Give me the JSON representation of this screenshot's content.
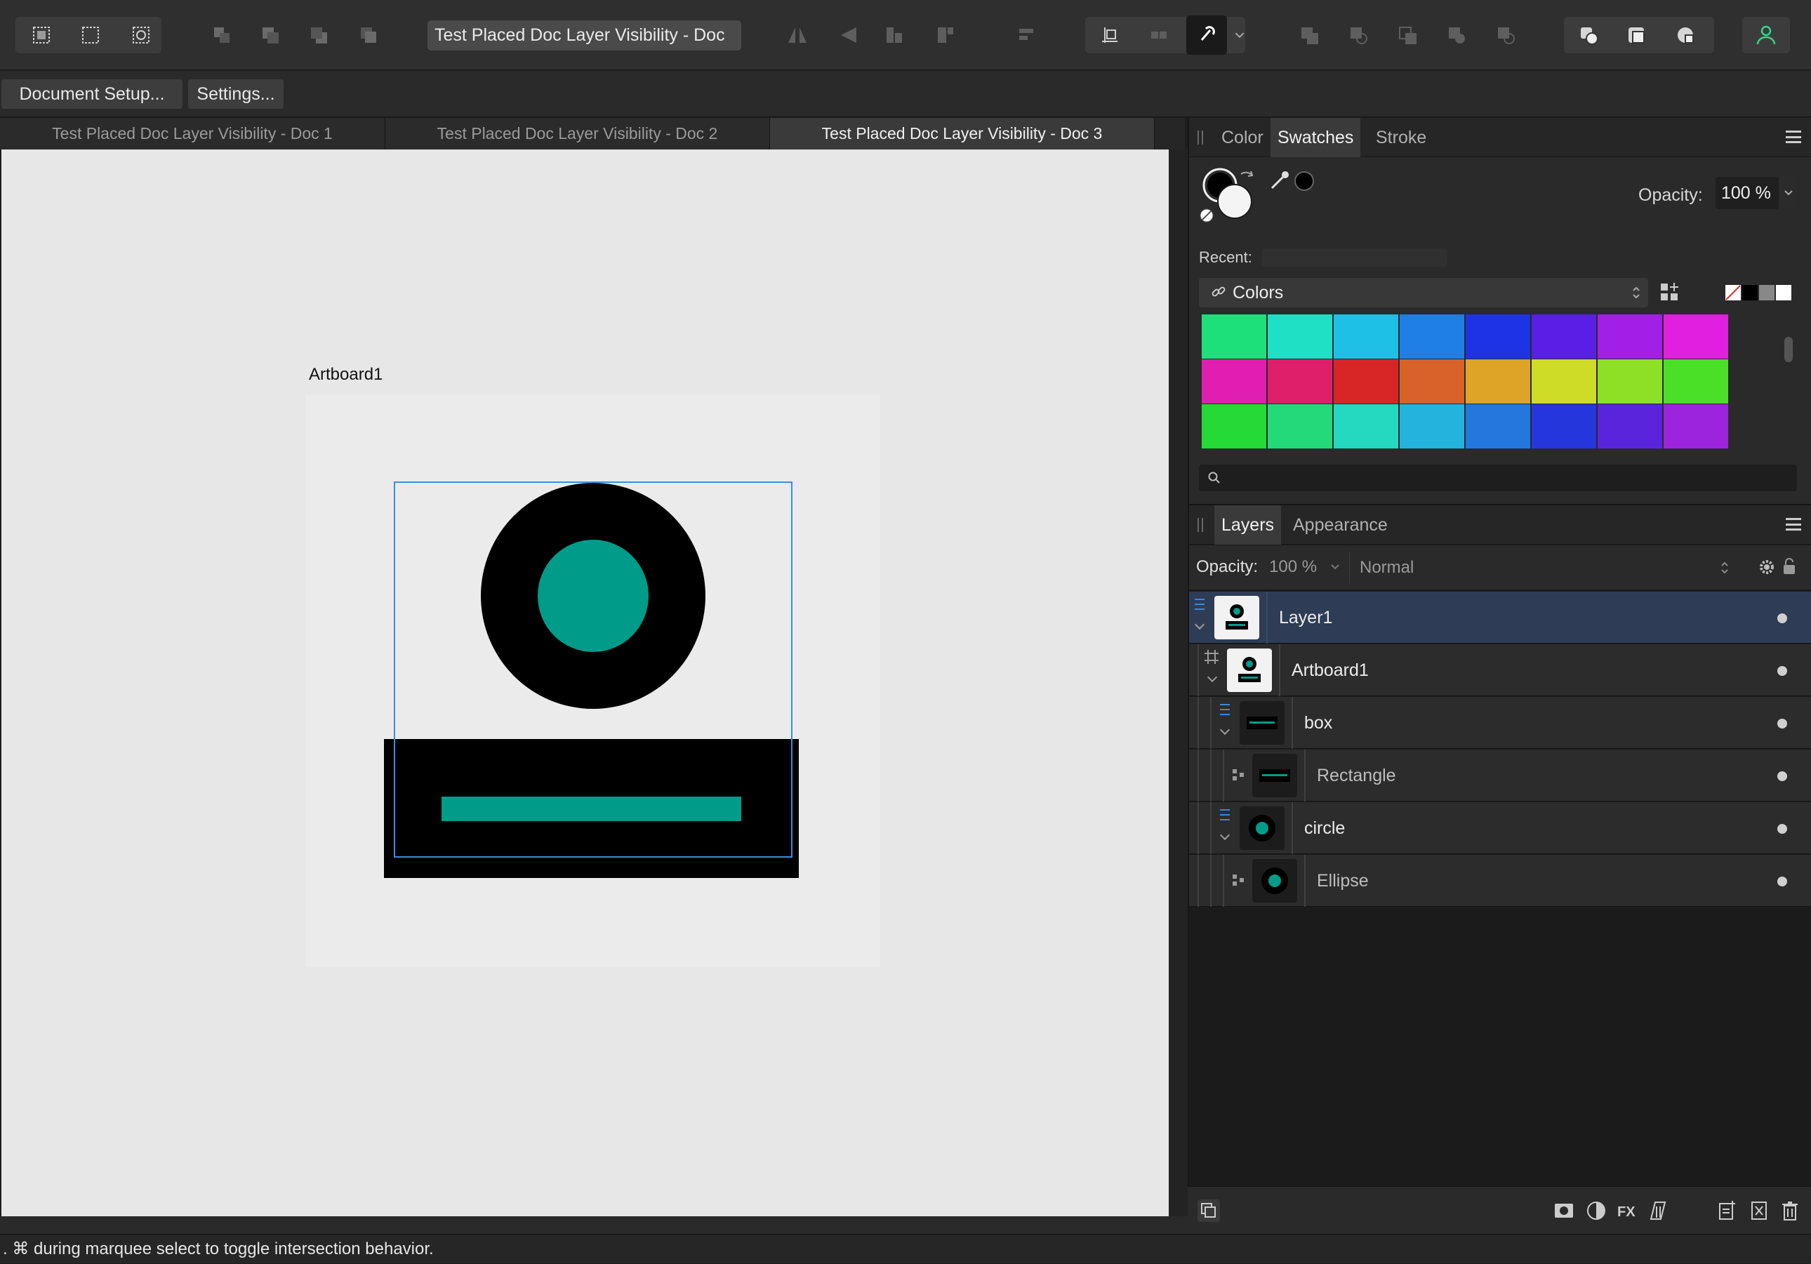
{
  "toolbar": {
    "document_title": "Test Placed Doc Layer Visibility - Doc",
    "icons": [
      "select-all-icon",
      "deselect-icon",
      "select-object-icon",
      "arrange-back-icon",
      "arrange-backward-icon",
      "arrange-forward-icon",
      "arrange-front-icon",
      "flip-horizontal-icon",
      "flip-vertical-icon",
      "rotate-left-icon",
      "rotate-right-icon",
      "align-icon",
      "snapping-icon",
      "transform-origin-icon",
      "snap-magnet-icon",
      "add-icon",
      "subtract-icon",
      "intersect-icon",
      "xor-icon",
      "divide-icon",
      "insert-behind-icon",
      "insert-inside-icon",
      "insert-front-icon",
      "persona-icon"
    ]
  },
  "context_bar": {
    "document_setup_label": "Document Setup...",
    "settings_label": "Settings..."
  },
  "doc_tabs": [
    {
      "label": "Test Placed Doc Layer Visibility - Doc 1",
      "active": false
    },
    {
      "label": "Test Placed Doc Layer Visibility - Doc 2",
      "active": false
    },
    {
      "label": "Test Placed Doc Layer Visibility - Doc 3",
      "active": true
    }
  ],
  "canvas": {
    "artboard_label": "Artboard1",
    "accent_color": "#009b89",
    "selection_color": "#3b8de0"
  },
  "swatches_panel": {
    "tabs": [
      "Color",
      "Swatches",
      "Stroke"
    ],
    "active_tab": "Swatches",
    "opacity_label": "Opacity:",
    "opacity_value": "100 %",
    "recent_label": "Recent:",
    "palette_name": "Colors",
    "colors": [
      [
        "#1de07a",
        "#1ee0c4",
        "#1ec0e6",
        "#1f7fe6",
        "#1f33e6",
        "#5a1fe6",
        "#a11fe6",
        "#e01fe0"
      ],
      [
        "#e01fb0",
        "#e01f6a",
        "#d82626",
        "#d9622a",
        "#dea427",
        "#cfdc27",
        "#8ee027",
        "#49e027"
      ],
      [
        "#25d937",
        "#24d97a",
        "#24d9c0",
        "#24b3dc",
        "#2477dc",
        "#2436dc",
        "#5a24dc",
        "#9b24dc"
      ]
    ]
  },
  "layers_panel": {
    "tabs": [
      "Layers",
      "Appearance"
    ],
    "active_tab": "Layers",
    "opacity_label": "Opacity:",
    "opacity_value": "100 %",
    "blend_mode": "Normal",
    "layers": [
      {
        "name": "Layer1",
        "selected": true
      },
      {
        "name": "Artboard1",
        "selected": false
      },
      {
        "name": "box",
        "selected": false
      },
      {
        "name": "Rectangle",
        "selected": false
      },
      {
        "name": "circle",
        "selected": false
      },
      {
        "name": "Ellipse",
        "selected": false
      }
    ]
  },
  "status_bar": {
    "text": ". ⌘ during marquee select to toggle intersection behavior."
  }
}
